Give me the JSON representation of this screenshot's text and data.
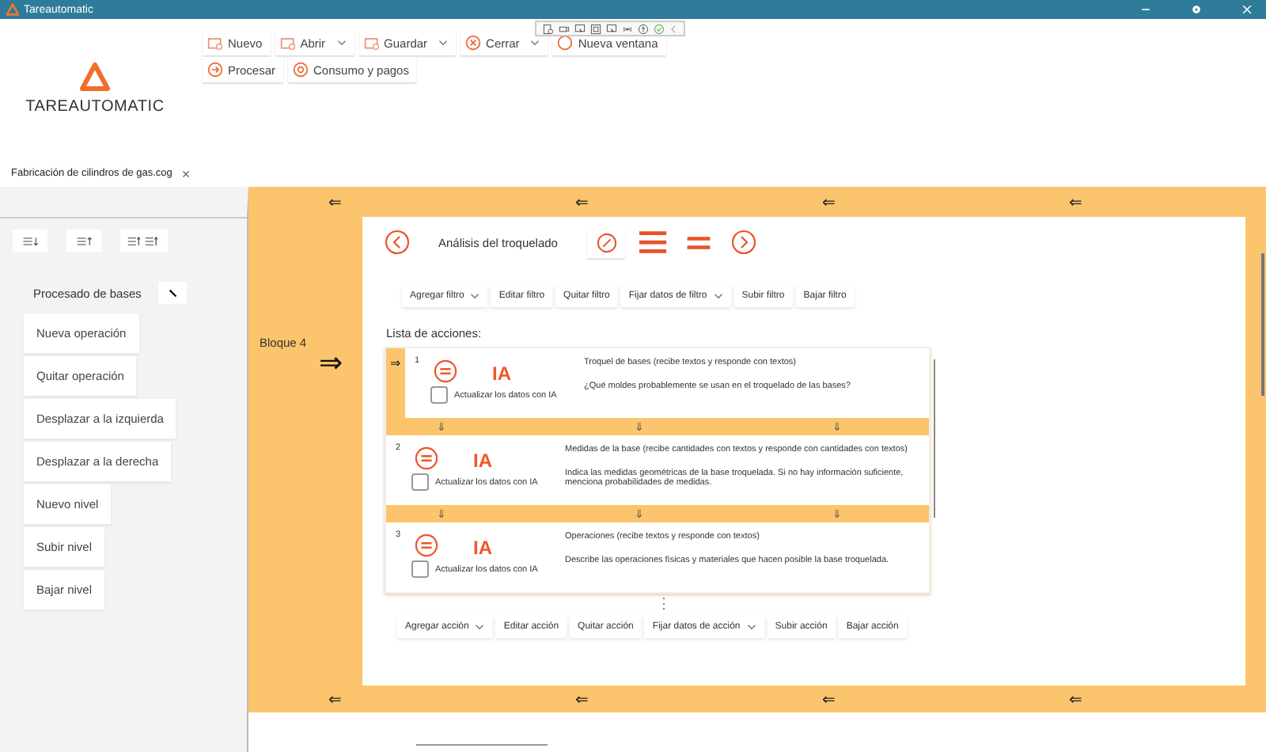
{
  "window": {
    "title": "Tareautomatic"
  },
  "logo": {
    "text": "TAREAUTOMATIC"
  },
  "toolbar_rows": [
    [
      {
        "label": "Nuevo",
        "kind": "document",
        "dropdown": false
      },
      {
        "label": "Abrir",
        "kind": "document",
        "dropdown": true
      },
      {
        "label": "Guardar",
        "kind": "document",
        "dropdown": true
      },
      {
        "label": "Cerrar",
        "kind": "close",
        "dropdown": true
      },
      {
        "label": "Nueva ventana",
        "kind": "window",
        "dropdown": false
      }
    ],
    [
      {
        "label": "Procesar",
        "kind": "arrow",
        "dropdown": false
      },
      {
        "label": "Consumo y pagos",
        "kind": "coin",
        "dropdown": false
      }
    ]
  ],
  "tabs": [
    {
      "label": "Fabricación de cilindros de gas.cog",
      "close": "×",
      "selected": true
    }
  ],
  "sidebar": {
    "title": "Procesado de bases",
    "buttons": [
      "Nueva operación",
      "Quitar operación",
      "Desplazar a la izquierda",
      "Desplazar a la derecha",
      "Nuevo nivel",
      "Subir nivel",
      "Bajar nivel"
    ]
  },
  "band_top": [
    "⇐",
    "⇐",
    "⇐",
    "⇐"
  ],
  "block": {
    "label": "Bloque 4",
    "arrow": "⇒"
  },
  "operation": {
    "title": "Análisis del troquelado"
  },
  "filter_toolbar": [
    {
      "label": "Agregar filtro",
      "dropdown": true
    },
    {
      "label": "Editar filtro",
      "dropdown": false
    },
    {
      "label": "Quitar filtro",
      "dropdown": false
    },
    {
      "label": "Fijar datos de filtro",
      "dropdown": true
    },
    {
      "label": "Subir filtro",
      "dropdown": false
    },
    {
      "label": "Bajar filtro",
      "dropdown": false
    }
  ],
  "actions_label": "Lista de acciones:",
  "current_marker": "⇒",
  "actions": [
    {
      "number": "1",
      "badge": "IA",
      "checkbox_label": "Actualizar los datos con IA",
      "checked": false,
      "selected": true,
      "title": "Troquel de bases (recibe textos y responde con textos)",
      "description": "¿Qué moldes probablemente se usan en el troquelado de las bases?",
      "arrows_below": [
        "⇓",
        "⇓",
        "⇓"
      ]
    },
    {
      "number": "2",
      "badge": "IA",
      "checkbox_label": "Actualizar los datos con IA",
      "checked": false,
      "selected": false,
      "title": "Medidas de la base (recibe cantidades con textos y responde con cantidades con textos)",
      "description": "Indica las medidas geométricas de la base troquelada. Si no hay información suficiente, menciona probabilidades de medidas.",
      "arrows_below": [
        "⇓",
        "⇓",
        "⇓"
      ]
    },
    {
      "number": "3",
      "badge": "IA",
      "checkbox_label": "Actualizar los datos con IA",
      "checked": false,
      "selected": false,
      "title": "Operaciones (recibe textos y responde con textos)",
      "description": "Describe las operaciones físicas y materiales que hacen posible la base troquelada."
    }
  ],
  "more": "⋮",
  "action_toolbar": [
    {
      "label": "Agregar acción",
      "dropdown": true
    },
    {
      "label": "Editar acción",
      "dropdown": false
    },
    {
      "label": "Quitar acción",
      "dropdown": false
    },
    {
      "label": "Fijar datos de acción",
      "dropdown": true
    },
    {
      "label": "Subir acción",
      "dropdown": false
    },
    {
      "label": "Bajar acción",
      "dropdown": false
    }
  ],
  "band_bottom": [
    "⇐",
    "⇐",
    "⇐",
    "⇐"
  ]
}
